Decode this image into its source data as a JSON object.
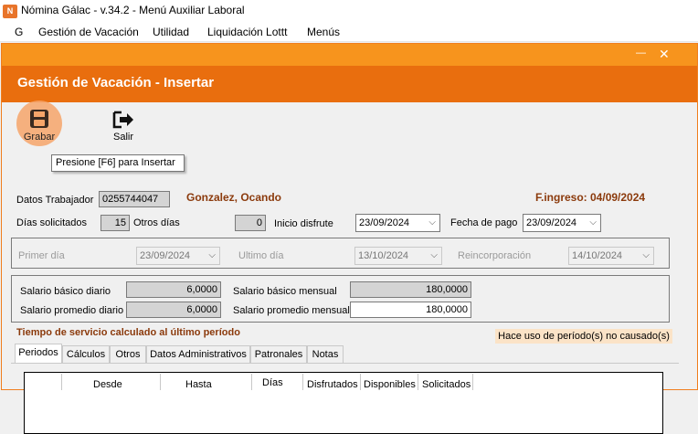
{
  "window": {
    "title": "Nómina Gálac  - v.34.2 - Menú Auxiliar Laboral",
    "icon": "nomina-app-icon"
  },
  "menubar": [
    "G",
    "Gestión de Vacación",
    "Utilidad",
    "Liquidación Lottt",
    "Menús"
  ],
  "form": {
    "title": "Gestión de Vacación - Insertar"
  },
  "toolbar": {
    "grabar": "Grabar",
    "salir": "Salir",
    "tooltip": "Presione [F6] para Insertar"
  },
  "trabajador": {
    "label": "Datos Trabajador",
    "cedula": "0255744047",
    "nombre": "Gonzalez, Ocando",
    "f_ingreso": "F.ingreso: 04/09/2024"
  },
  "dias": {
    "solicitados_label": "Días solicitados",
    "solicitados": "15",
    "otros_label": "Otros días",
    "otros": "0",
    "inicio_label": "Inicio disfrute",
    "inicio": "23/09/2024",
    "pago_label": "Fecha de pago",
    "pago": "23/09/2024"
  },
  "periodo": {
    "primer_label": "Primer día",
    "primer": "23/09/2024",
    "ultimo_label": "Ultimo día",
    "ultimo": "13/10/2024",
    "reinc_label": "Reincorporación",
    "reinc": "14/10/2024"
  },
  "salarios": {
    "basico_diario_label": "Salario básico diario",
    "basico_diario": "6,0000",
    "basico_mensual_label": "Salario básico mensual",
    "basico_mensual": "180,0000",
    "promedio_diario_label": "Salario promedio diario",
    "promedio_diario": "6,0000",
    "promedio_mensual_label": "Salario promedio mensual",
    "promedio_mensual": "180,0000"
  },
  "tiempo_servicio": "Tiempo de servicio calculado al último período",
  "hint": "Hace uso de período(s) no causado(s)",
  "tabs": [
    "Periodos",
    "Cálculos",
    "Otros",
    "Datos Administrativos",
    "Patronales",
    "Notas"
  ],
  "grid_columns": [
    "Desde",
    "Hasta",
    "Días",
    "Disfrutados",
    "Disponibles",
    "Solicitados"
  ]
}
